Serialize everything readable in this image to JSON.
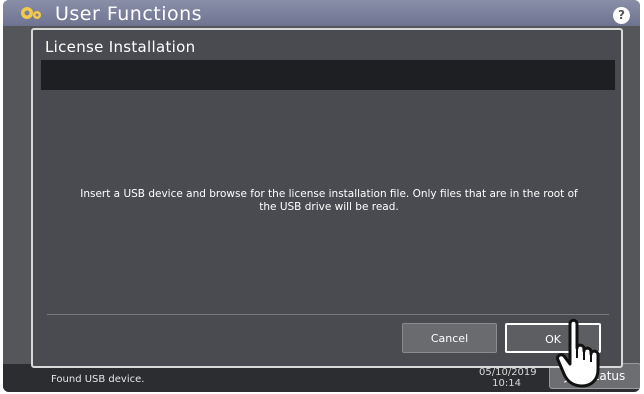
{
  "header": {
    "title": "User Functions",
    "help_icon_label": "?"
  },
  "dialog": {
    "title": "License Installation",
    "message": "Insert a USB device and browse for the license installation file. Only files that are in the root of the USB drive will be read.",
    "buttons": {
      "cancel_label": "Cancel",
      "ok_label": "OK"
    }
  },
  "status_bar": {
    "message": "Found USB device.",
    "date": "05/10/2019",
    "time": "10:14",
    "job_status_label": "Job Status"
  },
  "colors": {
    "screen_bg": "#55565a",
    "dialog_bg": "#4a4b50",
    "title_strip": "#1e1f22",
    "header_bar": "#7a7f9c"
  },
  "icons": [
    "gear-icon",
    "help-icon",
    "pointing-hand-icon"
  ]
}
